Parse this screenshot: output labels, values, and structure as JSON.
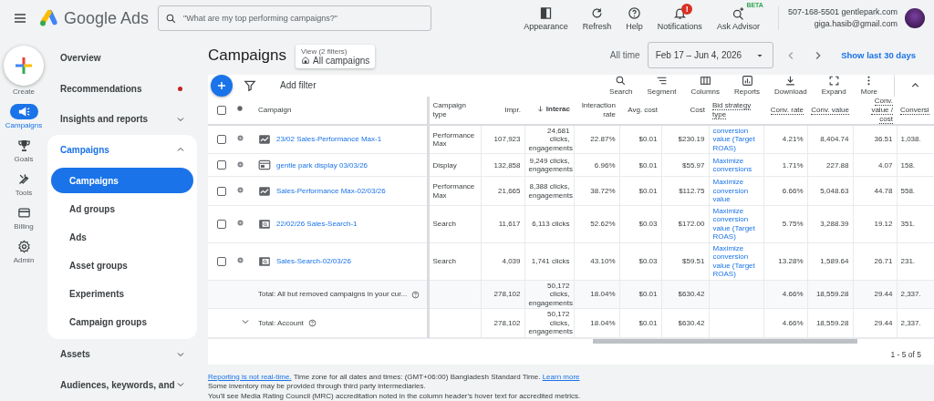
{
  "app": {
    "title": "Google Ads"
  },
  "search": {
    "placeholder": "\"What are my top performing campaigns?\""
  },
  "top_actions": [
    {
      "kind": "appearance",
      "label": "Appearance"
    },
    {
      "kind": "refresh",
      "label": "Refresh"
    },
    {
      "kind": "help",
      "label": "Help"
    },
    {
      "kind": "notifications",
      "label": "Notifications",
      "badge": "!"
    },
    {
      "kind": "advisor",
      "label": "Ask Advisor",
      "badge": "BETA"
    }
  ],
  "account": {
    "name": "507-168-5501 gentlepark.com",
    "email": "giga.hasib@gmail.com"
  },
  "rail": [
    {
      "kind": "create",
      "label": "Create",
      "selected": false
    },
    {
      "kind": "campaigns",
      "label": "Campaigns",
      "selected": true
    },
    {
      "kind": "goals",
      "label": "Goals",
      "selected": false
    },
    {
      "kind": "tools",
      "label": "Tools",
      "selected": false
    },
    {
      "kind": "billing",
      "label": "Billing",
      "selected": false
    },
    {
      "kind": "admin",
      "label": "Admin",
      "selected": false
    }
  ],
  "nav": [
    {
      "kind": "link",
      "label": "Overview",
      "alert": false
    },
    {
      "kind": "link",
      "label": "Recommendations",
      "alert": true
    },
    {
      "kind": "group",
      "label": "Insights and reports",
      "alert": false,
      "expanded": false
    },
    {
      "kind": "group",
      "label": "Campaigns",
      "alert": false,
      "expanded": true,
      "children": [
        {
          "label": "Campaigns",
          "selected": true
        },
        {
          "label": "Ad groups",
          "selected": false
        },
        {
          "label": "Ads",
          "selected": false
        },
        {
          "label": "Asset groups",
          "selected": false
        },
        {
          "label": "Experiments",
          "selected": false
        },
        {
          "label": "Campaign groups",
          "selected": false
        }
      ]
    },
    {
      "kind": "group",
      "label": "Assets",
      "alert": false,
      "expanded": false
    },
    {
      "kind": "group",
      "label": "Audiences, keywords, and",
      "alert": false,
      "expanded": false
    }
  ],
  "page": {
    "title": "Campaigns",
    "view": {
      "label": "View (2 filters)",
      "value": "All campaigns"
    },
    "date": {
      "label": "All time",
      "range": "Feb 17 – Jun 4, 2026",
      "shortcut": "Show last 30 days"
    }
  },
  "toolbar": {
    "add_filter": "Add filter",
    "tools": [
      {
        "kind": "search",
        "label": "Search"
      },
      {
        "kind": "segment",
        "label": "Segment"
      },
      {
        "kind": "columns",
        "label": "Columns"
      },
      {
        "kind": "reports",
        "label": "Reports"
      },
      {
        "kind": "download",
        "label": "Download"
      },
      {
        "kind": "expand",
        "label": "Expand"
      },
      {
        "kind": "more",
        "label": "More"
      }
    ]
  },
  "table": {
    "select_all_checked": false,
    "columns": [
      {
        "label": "Campaign",
        "dotted": false,
        "sorted": false
      },
      {
        "label": "Campaign type",
        "dotted": false,
        "sorted": false
      },
      {
        "label": "Impr.",
        "dotted": false,
        "sorted": false
      },
      {
        "label": "Interac",
        "dotted": false,
        "sorted": true
      },
      {
        "label": "Interaction rate",
        "dotted": false,
        "sorted": false
      },
      {
        "label": "Avg. cost",
        "dotted": false,
        "sorted": false
      },
      {
        "label": "Cost",
        "dotted": false,
        "sorted": false
      },
      {
        "label": "Bid strategy type",
        "dotted": true,
        "sorted": false
      },
      {
        "label": "Conv. rate",
        "dotted": true,
        "sorted": false
      },
      {
        "label": "Conv. value",
        "dotted": true,
        "sorted": false
      },
      {
        "label": "Conv. value / cost",
        "dotted": true,
        "sorted": false
      },
      {
        "label": "Conversi",
        "dotted": true,
        "sorted": false
      }
    ],
    "rows": [
      {
        "checked": false,
        "kind": "pmax",
        "cells": [
          "23/02 Sales-Performance Max-1",
          "Performance Max",
          "107,923",
          "24,681 clicks, engagements",
          "22.87%",
          "$0.01",
          "$230.19",
          "conversion value (Target ROAS)",
          "4.21%",
          "8,404.74",
          "36.51",
          "1,038."
        ]
      },
      {
        "checked": false,
        "kind": "display",
        "cells": [
          "gentle park display 03/03/26",
          "Display",
          "132,858",
          "9,249 clicks, engagements",
          "6.96%",
          "$0.01",
          "$55.97",
          "Maximize conversions",
          "1.71%",
          "227.88",
          "4.07",
          "158."
        ]
      },
      {
        "checked": false,
        "kind": "pmax",
        "cells": [
          "Sales-Performance Max-02/03/26",
          "Performance Max",
          "21,665",
          "8,388 clicks, engagements",
          "38.72%",
          "$0.01",
          "$112.75",
          "Maximize conversion value",
          "6.66%",
          "5,048.63",
          "44.78",
          "558."
        ]
      },
      {
        "checked": false,
        "kind": "search",
        "cells": [
          "22/02/26 Sales-Search-1",
          "Search",
          "11,617",
          "6,113 clicks",
          "52.62%",
          "$0.03",
          "$172.00",
          "Maximize conversion value (Target ROAS)",
          "5.75%",
          "3,288.39",
          "19.12",
          "351."
        ]
      },
      {
        "checked": false,
        "kind": "search",
        "cells": [
          "Sales-Search-02/03/26",
          "Search",
          "4,039",
          "1,741 clicks",
          "43.10%",
          "$0.03",
          "$59.51",
          "Maximize conversion value (Target ROAS)",
          "13.28%",
          "1,589.64",
          "26.71",
          "231."
        ]
      }
    ],
    "totals": [
      {
        "kind": "filtered",
        "label": "Total: All but removed campaigns in your cur...",
        "cells": [
          "",
          "278,102",
          "50,172 clicks, engagements",
          "18.04%",
          "$0.01",
          "$630.42",
          "",
          "4.66%",
          "18,559.28",
          "29.44",
          "2,337."
        ]
      },
      {
        "kind": "account",
        "label": "Total: Account",
        "cells": [
          "",
          "278,102",
          "50,172 clicks, engagements",
          "18.04%",
          "$0.01",
          "$630.42",
          "",
          "4.66%",
          "18,559.28",
          "29.44",
          "2,337."
        ]
      }
    ],
    "pagination": "1 - 5 of 5"
  },
  "footer": {
    "lines": [
      [
        {
          "kind": "link",
          "text": "Reporting is not real-time."
        },
        {
          "kind": "text",
          "text": "Time zone for all dates and times: (GMT+06:00) Bangladesh Standard Time."
        },
        {
          "kind": "link",
          "text": "Learn more"
        }
      ],
      [
        {
          "kind": "text",
          "text": "Some inventory may be provided through third party intermediaries."
        }
      ],
      [
        {
          "kind": "text",
          "text": "You'll see Media Rating Council (MRC) accreditation noted in the column header's hover text for accredited metrics."
        }
      ]
    ]
  }
}
